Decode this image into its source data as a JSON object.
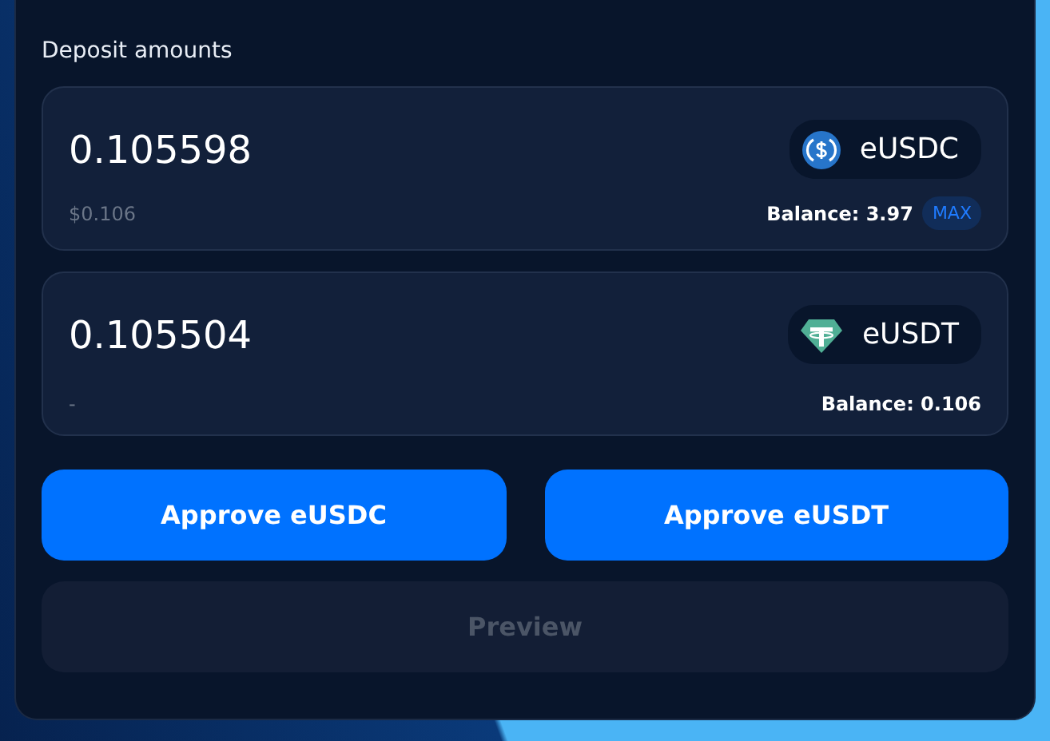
{
  "section_title": "Deposit amounts",
  "inputs": [
    {
      "amount": "0.105598",
      "token": {
        "kind": "usdc",
        "symbol": "eUSDC"
      },
      "usd_value": "$0.106",
      "balance": "Balance: 3.97",
      "max_label": "MAX"
    },
    {
      "amount": "0.105504",
      "token": {
        "kind": "usdt",
        "symbol": "eUSDT"
      },
      "usd_value": "-",
      "balance": "Balance: 0.106"
    }
  ],
  "approve_buttons": [
    {
      "label": "Approve eUSDC",
      "disabled": false
    },
    {
      "label": "Approve eUSDT",
      "disabled": false
    }
  ],
  "preview_button": {
    "label": "Preview",
    "disabled": true
  }
}
